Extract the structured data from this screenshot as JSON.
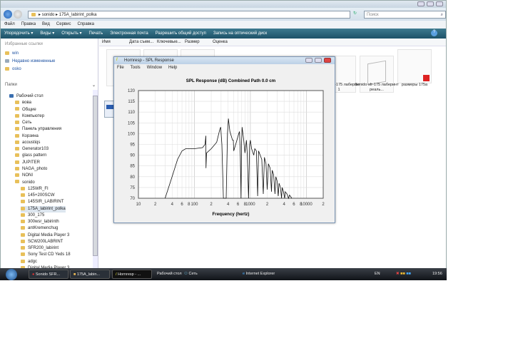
{
  "explorer": {
    "address_path": [
      "sonido",
      "175A_labirint_polka"
    ],
    "search_placeholder": "Поиск",
    "menu": [
      "Файл",
      "Правка",
      "Вид",
      "Сервис",
      "Справка"
    ],
    "toolbar": [
      "Упорядочить ▾",
      "Виды ▾",
      "Открыть ▾",
      "Печать",
      "Электронная почта",
      "Разрешить общий доступ",
      "Запись на оптический диск"
    ],
    "columns": [
      "Имя",
      "Дата съем...",
      "Ключевые...",
      "Размер",
      "Оценка"
    ],
    "favorites_header": "Избранные ссылки",
    "favorites": [
      "win",
      "Недавно измененные",
      "osko"
    ],
    "folders_header": "Папки",
    "tree": [
      "Рабочий стол",
      "вова",
      "Общие",
      "Компьютер",
      "Сеть",
      "Панель управления",
      "Корзина",
      "acoustiqs",
      "Generator103",
      "glass pattern",
      "JUPITER",
      "NAGA_photo",
      "NONI",
      "sonido",
      "125WR_FI",
      "145+200SCW",
      "145SIR_LABIRINT",
      "175A_labirint_polka",
      "300_175",
      "300wsr_labirinth",
      "antKremenchug",
      "Digital Media Player 3",
      "SCW200LABRINT",
      "SFR200_labirint",
      "Sony Test CD Yeds 18",
      "adgc",
      "Digital Media Player 3"
    ],
    "files": [
      {
        "label": "Sonido sfr-175 лаберинт 1"
      },
      {
        "label": "Sonido sfr-175 лаберинт реаль..."
      },
      {
        "label": "размеры 175a"
      }
    ]
  },
  "hornresp": {
    "title": "Hornresp - SPL Response",
    "menu": [
      "File",
      "Tools",
      "Window",
      "Help"
    ]
  },
  "chart_data": {
    "type": "line",
    "title": "SPL Response (dB)   Combined   Path 0.0 cm",
    "xlabel": "Frequency (hertz)",
    "ylabel": "",
    "xscale": "log",
    "xlim": [
      10,
      20000
    ],
    "ylim": [
      70,
      120
    ],
    "xticks": [
      [
        10,
        "10"
      ],
      [
        20,
        "2"
      ],
      [
        40,
        "4"
      ],
      [
        60,
        "6"
      ],
      [
        80,
        "8"
      ],
      [
        100,
        "100"
      ],
      [
        200,
        "2"
      ],
      [
        400,
        "4"
      ],
      [
        600,
        "6"
      ],
      [
        800,
        "8"
      ],
      [
        1000,
        "1000"
      ],
      [
        2000,
        "2"
      ],
      [
        4000,
        "4"
      ],
      [
        6000,
        "6"
      ],
      [
        8000,
        "8"
      ],
      [
        10000,
        "10000"
      ],
      [
        20000,
        "2"
      ]
    ],
    "yticks": [
      120,
      115,
      110,
      105,
      100,
      95,
      90,
      85,
      80,
      75,
      70
    ],
    "grid": true,
    "series": [
      {
        "name": "SPL",
        "points": [
          [
            30,
            70
          ],
          [
            40,
            80
          ],
          [
            50,
            88
          ],
          [
            60,
            92
          ],
          [
            70,
            93
          ],
          [
            100,
            93
          ],
          [
            140,
            93.5
          ],
          [
            155,
            95
          ],
          [
            160,
            99
          ],
          [
            161,
            84
          ],
          [
            165,
            91
          ],
          [
            200,
            93
          ],
          [
            250,
            96
          ],
          [
            285,
            102
          ],
          [
            295,
            103
          ],
          [
            310,
            95
          ],
          [
            330,
            70
          ],
          [
            370,
            70
          ],
          [
            390,
            100
          ],
          [
            405,
            107
          ],
          [
            430,
            101
          ],
          [
            480,
            97
          ],
          [
            495,
            97
          ],
          [
            505,
            92
          ],
          [
            560,
            96
          ],
          [
            620,
            100
          ],
          [
            640,
            101
          ],
          [
            660,
            90
          ],
          [
            680,
            70
          ],
          [
            695,
            95
          ],
          [
            710,
            103
          ],
          [
            760,
            97
          ],
          [
            800,
            91
          ],
          [
            850,
            97
          ],
          [
            880,
            90
          ],
          [
            930,
            70
          ],
          [
            970,
            95
          ],
          [
            1000,
            97
          ],
          [
            1050,
            93
          ],
          [
            1150,
            90
          ],
          [
            1200,
            93
          ],
          [
            1280,
            92
          ],
          [
            1350,
            71
          ],
          [
            1400,
            92
          ],
          [
            1500,
            90
          ],
          [
            1600,
            88
          ],
          [
            1700,
            72
          ],
          [
            1780,
            89
          ],
          [
            1900,
            86
          ],
          [
            2000,
            74
          ],
          [
            2100,
            86
          ],
          [
            2250,
            84
          ],
          [
            2380,
            73
          ],
          [
            2450,
            83
          ],
          [
            2600,
            81
          ],
          [
            2750,
            72
          ],
          [
            2850,
            80
          ],
          [
            3000,
            78
          ],
          [
            3150,
            71
          ],
          [
            3250,
            77
          ],
          [
            3450,
            75
          ],
          [
            3600,
            70
          ],
          [
            3700,
            75
          ],
          [
            3900,
            73
          ],
          [
            4100,
            70
          ],
          [
            4200,
            73
          ],
          [
            4500,
            72
          ],
          [
            4800,
            70
          ],
          [
            5000,
            71.5
          ],
          [
            5500,
            70
          ]
        ]
      }
    ]
  },
  "taskbar": {
    "tasks": [
      "Sonido SFR...",
      "175A_labin...",
      "Hornresp - ..."
    ],
    "quick": [
      "Рабочий стол",
      "Сеть",
      "Internet Explorer"
    ],
    "lang": "EN",
    "clock": "19:56"
  }
}
